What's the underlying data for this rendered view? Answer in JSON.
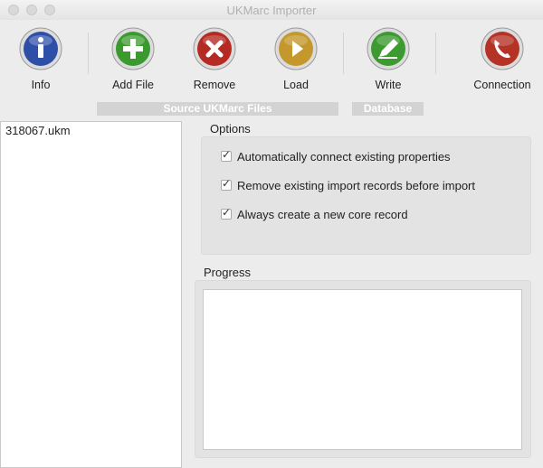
{
  "window": {
    "title": "UKMarc Importer"
  },
  "toolbar": {
    "info_label": "Info",
    "add_file_label": "Add File",
    "remove_label": "Remove",
    "load_label": "Load",
    "write_label": "Write",
    "connection_label": "Connection",
    "source_group_label": "Source UKMarc Files",
    "database_group_label": "Database"
  },
  "files": [
    "318067.ukm"
  ],
  "options": {
    "title": "Options",
    "items": [
      {
        "label": "Automatically connect existing properties",
        "checked": true
      },
      {
        "label": "Remove existing import records before import",
        "checked": true
      },
      {
        "label": "Always create a new core record",
        "checked": true
      }
    ]
  },
  "progress": {
    "title": "Progress"
  },
  "colors": {
    "info": "#2e4fa8",
    "add_file": "#3a9a2e",
    "remove": "#b52a22",
    "load": "#c4982c",
    "write": "#3c9a30",
    "connection": "#b53326"
  }
}
